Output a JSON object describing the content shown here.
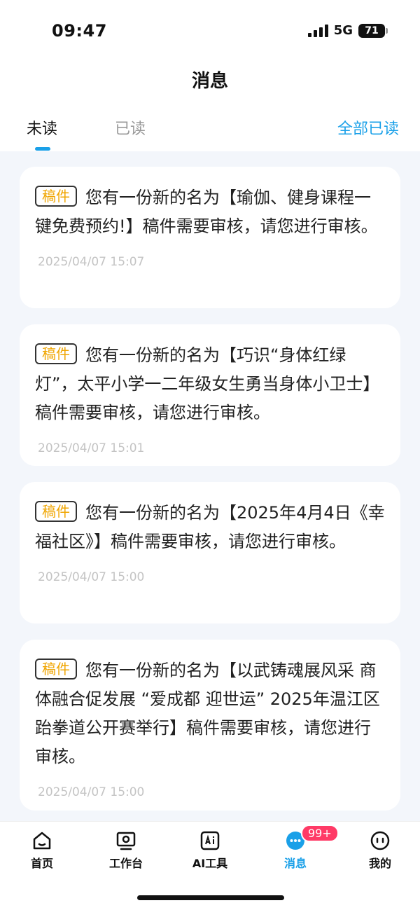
{
  "status": {
    "time": "09:47",
    "network": "5G",
    "battery": "71"
  },
  "header": {
    "title": "消息"
  },
  "tabs": {
    "unread": "未读",
    "read": "已读",
    "mark_all_read": "全部已读"
  },
  "messages": [
    {
      "tag": "稿件",
      "text": "您有一份新的名为【瑜伽、健身课程一键免费预约!】稿件需要审核，请您进行审核。",
      "time": "2025/04/07 15:07"
    },
    {
      "tag": "稿件",
      "text": "您有一份新的名为【巧识“身体红绿灯”，太平小学一二年级女生勇当身体小卫士】稿件需要审核，请您进行审核。",
      "time": "2025/04/07 15:01"
    },
    {
      "tag": "稿件",
      "text": "您有一份新的名为【2025年4月4日《幸福社区》】稿件需要审核，请您进行审核。",
      "time": "2025/04/07 15:00"
    },
    {
      "tag": "稿件",
      "text": "您有一份新的名为【以武铸魂展风采 商体融合促发展 “爱成都 迎世运” 2025年温江区跆拳道公开赛举行】稿件需要审核，请您进行审核。",
      "time": "2025/04/07 15:00"
    }
  ],
  "tabbar": {
    "items": [
      {
        "label": "首页",
        "icon": "home-icon"
      },
      {
        "label": "工作台",
        "icon": "workbench-icon"
      },
      {
        "label": "AI工具",
        "icon": "ai-tools-icon"
      },
      {
        "label": "消息",
        "icon": "message-icon",
        "badge": "99+"
      },
      {
        "label": "我的",
        "icon": "profile-icon"
      }
    ]
  },
  "colors": {
    "accent": "#1aa0e8",
    "tag_text": "#f0a500",
    "badge": "#ff3a66"
  }
}
